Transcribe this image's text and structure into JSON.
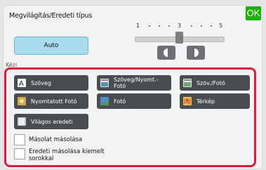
{
  "header": {
    "title": "Megvilágítás/Eredeti típus",
    "ok_label": "OK"
  },
  "exposure": {
    "scale_labels": [
      "1",
      "3",
      "5"
    ],
    "level": 3,
    "auto_label": "Auto",
    "manual_label": "Kézi"
  },
  "original_types": [
    {
      "label": "Szöveg",
      "icon": "text-doc-icon"
    },
    {
      "label": "Szöveg/Nyomt.-Fotó",
      "icon": "text-printed-photo-icon"
    },
    {
      "label": "Szöv./Fotó",
      "icon": "text-photo-icon"
    },
    {
      "label": "Nyomtatott Fotó",
      "icon": "printed-photo-icon"
    },
    {
      "label": "Fotó",
      "icon": "photo-icon"
    },
    {
      "label": "Térkép",
      "icon": "map-icon"
    },
    {
      "label": "Világos eredeti",
      "icon": "light-original-icon"
    }
  ],
  "options": [
    {
      "label": "Másolat másolása",
      "checked": false
    },
    {
      "label": "Eredeti másolása kiemelt sorokkal",
      "checked": false
    }
  ],
  "colors": {
    "ok": "#19b200",
    "highlight": "#dd1c3a",
    "auto": "#a9dcec",
    "button": "#4a4d50"
  }
}
